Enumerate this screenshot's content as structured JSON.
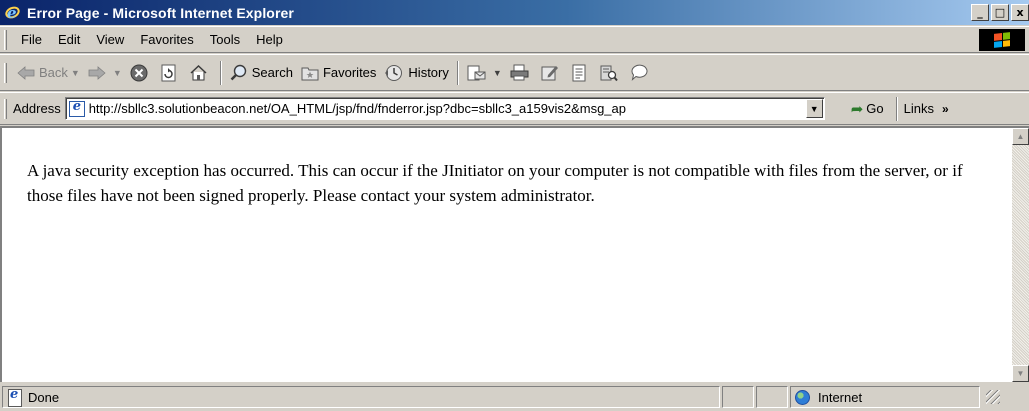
{
  "window": {
    "title": "Error Page - Microsoft Internet Explorer",
    "buttons": {
      "minimize": "_",
      "maximize": "□",
      "close": "x"
    }
  },
  "menu": {
    "items": [
      {
        "label": "File"
      },
      {
        "label": "Edit"
      },
      {
        "label": "View"
      },
      {
        "label": "Favorites"
      },
      {
        "label": "Tools"
      },
      {
        "label": "Help"
      }
    ]
  },
  "toolbar": {
    "back_label": "Back",
    "search_label": "Search",
    "favorites_label": "Favorites",
    "history_label": "History"
  },
  "address": {
    "label": "Address",
    "url": "http://sbllc3.solutionbeacon.net/OA_HTML/jsp/fnd/fnderror.jsp?dbc=sbllc3_a159vis2&msg_ap",
    "go_label": "Go",
    "links_label": "Links",
    "links_chevron": "»"
  },
  "content": {
    "message": "A java security exception has occurred. This can occur if the JInitiator on your computer is not compatible with files from the server, or if those files have not been signed properly. Please contact your system administrator."
  },
  "status": {
    "text": "Done",
    "zone": "Internet"
  },
  "colors": {
    "titlebar_start": "#0a246a",
    "titlebar_end": "#a6caf0",
    "chrome": "#d4d0c8"
  }
}
